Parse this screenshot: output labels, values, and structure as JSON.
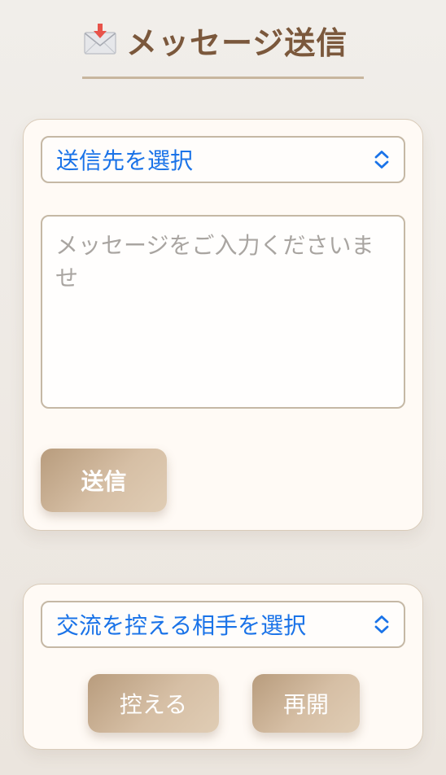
{
  "header": {
    "icon": "incoming-envelope-icon",
    "title": "メッセージ送信"
  },
  "message_card": {
    "recipient_select": {
      "selected": "送信先を選択",
      "icon": "chevron-up-down-icon"
    },
    "message_input": {
      "value": "",
      "placeholder": "メッセージをご入力くださいませ"
    },
    "send_button_label": "送信"
  },
  "block_card": {
    "block_select": {
      "selected": "交流を控える相手を選択",
      "icon": "chevron-up-down-icon"
    },
    "block_button_label": "控える",
    "resume_button_label": "再開"
  },
  "colors": {
    "background": "#eee9e3",
    "title": "#7b583c",
    "card": "#fffaf5",
    "select_text": "#1a73e8",
    "button_gradient_start": "#b89c7d",
    "button_gradient_end": "#e0cdb5"
  }
}
